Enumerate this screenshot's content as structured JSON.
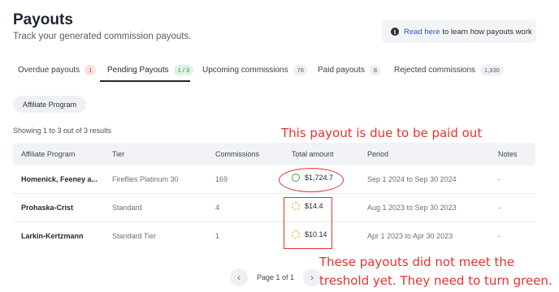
{
  "header": {
    "title": "Payouts",
    "subtitle": "Track your generated commission payouts.",
    "info_link": "Read here",
    "info_text": "to learn how payouts work",
    "info_icon": "info-icon"
  },
  "tabs": [
    {
      "label": "Overdue payouts",
      "count": "1",
      "badge_color": "#fde2e2"
    },
    {
      "label": "Pending Payouts",
      "count": "1 / 3",
      "badge_color": "#dff3e3",
      "active": true
    },
    {
      "label": "Upcoming commissions",
      "count": "76"
    },
    {
      "label": "Paid payouts",
      "count": "8"
    },
    {
      "label": "Rejected commissions",
      "count": "1,330"
    }
  ],
  "filter": {
    "label": "Affiliate Program"
  },
  "results": {
    "showing": "Showing 1 to 3 out of 3 results"
  },
  "table": {
    "headers": [
      "Affiliate Program",
      "Tier",
      "Commissions",
      "Total amount",
      "Period",
      "Notes"
    ],
    "rows": [
      {
        "program": "Homenick, Feeney a...",
        "tier": "Fireflies Platinum 30",
        "commissions": "169",
        "amount": "$1,724.7",
        "status": "due",
        "period": "Sep 1 2024 to Sep 30 2024",
        "notes": "-"
      },
      {
        "program": "Prohaska-Crist",
        "tier": "Standard",
        "commissions": "4",
        "amount": "$14.4",
        "status": "pending",
        "period": "Aug 1 2023 to Sep 30 2023",
        "notes": "-"
      },
      {
        "program": "Larkin-Kertzmann",
        "tier": "Standard Tier",
        "commissions": "1",
        "amount": "$10.14",
        "status": "pending",
        "period": "Apr 1 2023 to Apr 30 2023",
        "notes": "-"
      }
    ]
  },
  "annotations": {
    "top": "This payout is due to be paid out",
    "bottom_line1": "These payouts did not meet the",
    "bottom_line2": "treshold yet. They need to turn green.",
    "color": "#e8312f"
  },
  "pagination": {
    "label": "Page 1 of 1",
    "prev_icon": "chevron-left-icon",
    "next_icon": "chevron-right-icon"
  },
  "colors": {
    "due": "#3aa657",
    "pending": "#f0a21b",
    "link": "#2a55c8"
  }
}
